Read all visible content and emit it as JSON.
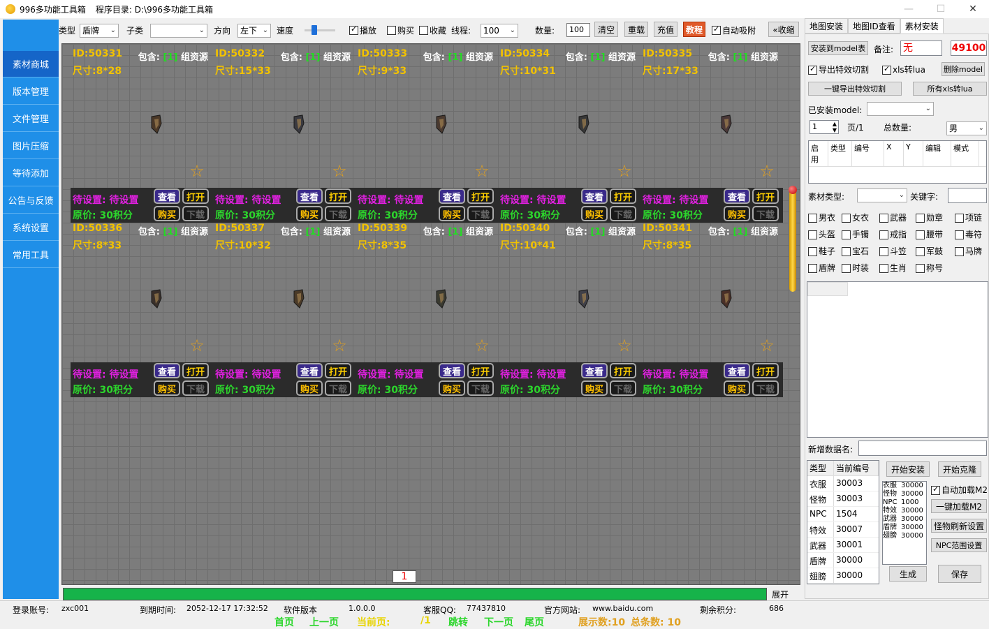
{
  "window": {
    "title": "996多功能工具箱",
    "program_dir": "程序目录: D:\\996多功能工具箱",
    "minimize": "—",
    "maximize": "☐",
    "close": "✕"
  },
  "sidebar": {
    "items": [
      {
        "label": "素材商城",
        "active": true
      },
      {
        "label": "版本管理"
      },
      {
        "label": "文件管理"
      },
      {
        "label": "图片压缩"
      },
      {
        "label": "等待添加"
      },
      {
        "label": "公告与反馈"
      },
      {
        "label": "系统设置"
      },
      {
        "label": "常用工具"
      }
    ]
  },
  "toolbar": {
    "type_label": "类型",
    "type_value": "盾牌",
    "subtype_label": "子类",
    "subtype_value": "",
    "direction_label": "方向",
    "direction_value": "左下",
    "speed_label": "速度",
    "speed_value": 0.25,
    "play_label": "播放",
    "play_checked": true,
    "buy_label": "购买",
    "buy_checked": false,
    "collect_label": "收藏",
    "collect_checked": false,
    "thread_label": "线程:",
    "thread_value": "100",
    "count_label": "数量:",
    "count_value": "100",
    "clear_label": "清空",
    "reload_label": "重载",
    "recharge_label": "充值",
    "tutorial_label": "教程",
    "auto_attach_label": "自动吸附",
    "auto_attach_checked": true,
    "collapse_label": "«收缩"
  },
  "cards": [
    {
      "id": "ID:50331",
      "size": "尺寸:8*28",
      "include_prefix": "包含:",
      "include_num": "[1]",
      "include_suffix": "组资源",
      "pending": "待设置: 待设置",
      "price": "原价: 30积分"
    },
    {
      "id": "ID:50332",
      "size": "尺寸:15*33",
      "include_prefix": "包含:",
      "include_num": "[1]",
      "include_suffix": "组资源",
      "pending": "待设置: 待设置",
      "price": "原价: 30积分"
    },
    {
      "id": "ID:50333",
      "size": "尺寸:9*33",
      "include_prefix": "包含:",
      "include_num": "[1]",
      "include_suffix": "组资源",
      "pending": "待设置: 待设置",
      "price": "原价: 30积分"
    },
    {
      "id": "ID:50334",
      "size": "尺寸:10*31",
      "include_prefix": "包含:",
      "include_num": "[1]",
      "include_suffix": "组资源",
      "pending": "待设置: 待设置",
      "price": "原价: 30积分"
    },
    {
      "id": "ID:50335",
      "size": "尺寸:17*33",
      "include_prefix": "包含:",
      "include_num": "[1]",
      "include_suffix": "组资源",
      "pending": "待设置: 待设置",
      "price": "原价: 30积分"
    },
    {
      "id": "ID:50336",
      "size": "尺寸:8*33",
      "include_prefix": "包含:",
      "include_num": "[1]",
      "include_suffix": "组资源",
      "pending": "待设置: 待设置",
      "price": "原价: 30积分"
    },
    {
      "id": "ID:50337",
      "size": "尺寸:10*32",
      "include_prefix": "包含:",
      "include_num": "[1]",
      "include_suffix": "组资源",
      "pending": "待设置: 待设置",
      "price": "原价: 30积分"
    },
    {
      "id": "ID:50339",
      "size": "尺寸:8*35",
      "include_prefix": "包含:",
      "include_num": "[1]",
      "include_suffix": "组资源",
      "pending": "待设置: 待设置",
      "price": "原价: 30积分"
    },
    {
      "id": "ID:50340",
      "size": "尺寸:10*41",
      "include_prefix": "包含:",
      "include_num": "[1]",
      "include_suffix": "组资源",
      "pending": "待设置: 待设置",
      "price": "原价: 30积分"
    },
    {
      "id": "ID:50341",
      "size": "尺寸:8*35",
      "include_prefix": "包含:",
      "include_num": "[1]",
      "include_suffix": "组资源",
      "pending": "待设置: 待设置",
      "price": "原价: 30积分"
    }
  ],
  "card_buttons": {
    "view": "查看",
    "open": "打开",
    "buy": "购买",
    "download": "下载"
  },
  "pager": {
    "first": "首页",
    "prev": "上一页",
    "current_label": "当前页:",
    "current": "1",
    "total": "/1",
    "jump": "跳转",
    "next": "下一页",
    "last": "尾页",
    "shown": "展示数:10",
    "total_count": "总条数: 10"
  },
  "progress": {
    "value": 1.0,
    "expand_label": "展开"
  },
  "status": {
    "account_label": "登录账号:",
    "account": "zxc001",
    "expire_label": "到期时间:",
    "expire": "2052-12-17 17:32:52",
    "version_label": "软件版本",
    "version": "1.0.0.0",
    "qq_label": "客服QQ:",
    "qq": "77437810",
    "site_label": "官方网站:",
    "site": "www.baidu.com",
    "points_label": "剩余积分:",
    "points": "686"
  },
  "right_panel": {
    "tabs": [
      "地图安装",
      "地图ID查看",
      "素材安装"
    ],
    "install_model_btn": "安装到model表",
    "note_label": "备注:",
    "note_value": "无",
    "code_value": "49100",
    "export_cut_label": "导出特效切割",
    "export_cut_checked": true,
    "xls_lua_label": "xls转lua",
    "xls_lua_checked": true,
    "delete_model_btn": "删除model",
    "one_click_export_btn": "一键导出特效切割",
    "all_xls_btn": "所有xls转lua",
    "installed_model_label": "已安装model:",
    "page_value": "1",
    "page_label": "页/1",
    "total_label": "总数量:",
    "gender_value": "男",
    "model_table_headers": [
      "启用",
      "类型",
      "编号",
      "X",
      "Y",
      "编辑",
      "模式"
    ],
    "material_type_label": "素材类型:",
    "keyword_label": "关键字:",
    "categories": [
      [
        "男衣",
        "女衣",
        "武器",
        "勋章",
        "项链"
      ],
      [
        "头盔",
        "手镯",
        "戒指",
        "腰带",
        "毒符"
      ],
      [
        "鞋子",
        "宝石",
        "斗笠",
        "军鼓",
        "马牌"
      ],
      [
        "盾牌",
        "时装",
        "生肖",
        "称号"
      ]
    ],
    "new_data_label": "新增数据名:",
    "type_table_headers": [
      "类型",
      "当前编号"
    ],
    "type_table_rows": [
      [
        "衣服",
        "30003"
      ],
      [
        "怪物",
        "30003"
      ],
      [
        "NPC",
        "1504"
      ],
      [
        "特效",
        "30007"
      ],
      [
        "武器",
        "30001"
      ],
      [
        "盾牌",
        "30000"
      ],
      [
        "翅膀",
        "30000"
      ]
    ],
    "start_install_btn": "开始安装",
    "start_clone_btn": "开始克隆",
    "mini_list": [
      [
        "衣服",
        "30000"
      ],
      [
        "怪物",
        "30000"
      ],
      [
        "NPC",
        "1000"
      ],
      [
        "特效",
        "30000"
      ],
      [
        "武器",
        "30000"
      ],
      [
        "盾牌",
        "30000"
      ],
      [
        "翅膀",
        "30000"
      ]
    ],
    "auto_load_m2_label": "自动加载M2",
    "auto_load_m2_checked": true,
    "one_click_load_btn": "一键加载M2",
    "monster_refresh_btn": "怪物刷新设置",
    "npc_range_btn": "NPC范围设置",
    "generate_btn": "生成",
    "save_btn": "保存"
  },
  "colors": {
    "sidebar_bg": "#1f8fe8",
    "sidebar_active": "#1565c8",
    "id_text": "#f2c200",
    "pending_text": "#e020e0",
    "price_text": "#2cd62c",
    "progress": "#16b34a",
    "code_red": "#e00000"
  }
}
